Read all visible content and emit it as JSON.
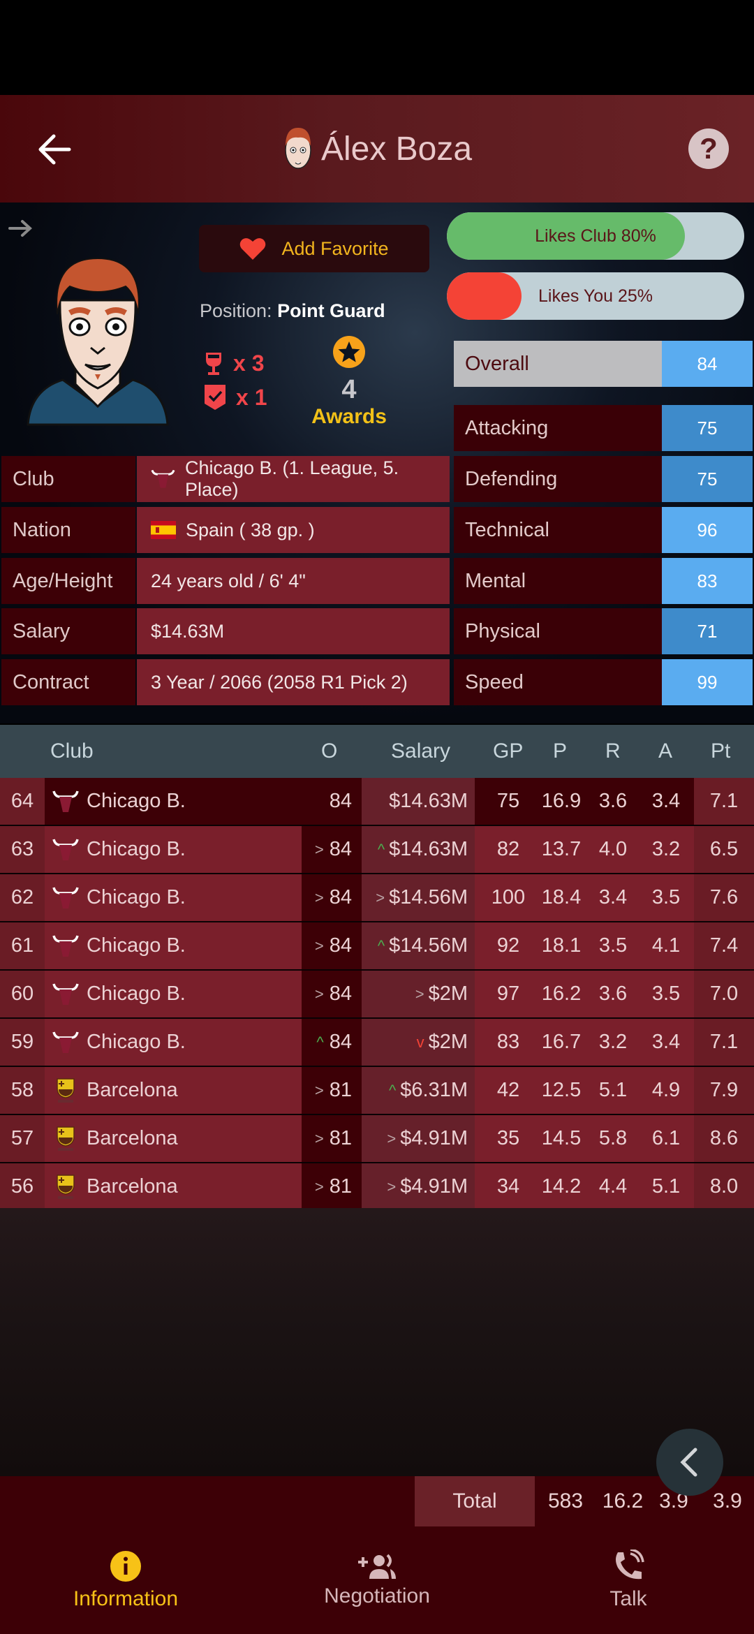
{
  "header": {
    "title": "Álex Boza",
    "back_icon": "arrow-left-icon",
    "help_icon": "question-mark-icon"
  },
  "profile": {
    "favorite_label": "Add Favorite",
    "position_label": "Position:",
    "position_value": "Point Guard",
    "trophies": [
      {
        "icon": "goblet-icon",
        "count": "x 3"
      },
      {
        "icon": "shield-check-icon",
        "count": "x 1"
      }
    ],
    "awards": {
      "count": "4",
      "label": "Awards",
      "icon": "star-badge-icon"
    }
  },
  "mood": [
    {
      "label": "Likes Club 80%",
      "value": 0.8,
      "color": "#66bb6a"
    },
    {
      "label": "Likes You 25%",
      "value": 0.25,
      "color": "#f44336"
    }
  ],
  "attributes": [
    {
      "name": "Overall",
      "value": "84",
      "color": "#5aacf0"
    },
    {
      "name": "Attacking",
      "value": "75",
      "color": "#3e8bcb"
    },
    {
      "name": "Defending",
      "value": "75",
      "color": "#3e8bcb"
    },
    {
      "name": "Technical",
      "value": "96",
      "color": "#5aacf0"
    },
    {
      "name": "Mental",
      "value": "83",
      "color": "#5aacf0"
    },
    {
      "name": "Physical",
      "value": "71",
      "color": "#3e8bcb"
    },
    {
      "name": "Speed",
      "value": "99",
      "color": "#5aacf0"
    }
  ],
  "info": [
    {
      "key": "Club",
      "value": "Chicago B. (1. League, 5. Place)",
      "icon": "bull-logo-icon"
    },
    {
      "key": "Nation",
      "value": "Spain  ( 38 gp. )",
      "icon": "spain-flag-icon"
    },
    {
      "key": "Age/Height",
      "value": "24 years old / 6' 4\""
    },
    {
      "key": "Salary",
      "value": "$14.63M"
    },
    {
      "key": "Contract",
      "value": "3 Year / 2066   (2058 R1 Pick 2)"
    }
  ],
  "history": {
    "columns": [
      "Club",
      "O",
      "Salary",
      "GP",
      "P",
      "R",
      "A",
      "Pt"
    ],
    "rows": [
      {
        "season": "64",
        "club": "Chicago B.",
        "logo": "bull",
        "ovr_trend": "",
        "ovr": "84",
        "sal_trend": "",
        "salary": "$14.63M",
        "gp": "75",
        "p": "16.9",
        "r": "3.6",
        "a": "3.4",
        "pt": "7.1",
        "current": true
      },
      {
        "season": "63",
        "club": "Chicago B.",
        "logo": "bull",
        "ovr_trend": "same",
        "ovr": "84",
        "sal_trend": "up",
        "salary": "$14.63M",
        "gp": "82",
        "p": "13.7",
        "r": "4.0",
        "a": "3.2",
        "pt": "6.5"
      },
      {
        "season": "62",
        "club": "Chicago B.",
        "logo": "bull",
        "ovr_trend": "same",
        "ovr": "84",
        "sal_trend": "same",
        "salary": "$14.56M",
        "gp": "100",
        "p": "18.4",
        "r": "3.4",
        "a": "3.5",
        "pt": "7.6"
      },
      {
        "season": "61",
        "club": "Chicago B.",
        "logo": "bull",
        "ovr_trend": "same",
        "ovr": "84",
        "sal_trend": "up",
        "salary": "$14.56M",
        "gp": "92",
        "p": "18.1",
        "r": "3.5",
        "a": "4.1",
        "pt": "7.4"
      },
      {
        "season": "60",
        "club": "Chicago B.",
        "logo": "bull",
        "ovr_trend": "same",
        "ovr": "84",
        "sal_trend": "same",
        "salary": "$2M",
        "gp": "97",
        "p": "16.2",
        "r": "3.6",
        "a": "3.5",
        "pt": "7.0"
      },
      {
        "season": "59",
        "club": "Chicago B.",
        "logo": "bull",
        "ovr_trend": "up",
        "ovr": "84",
        "sal_trend": "down",
        "salary": "$2M",
        "gp": "83",
        "p": "16.7",
        "r": "3.2",
        "a": "3.4",
        "pt": "7.1"
      },
      {
        "season": "58",
        "club": "Barcelona",
        "logo": "barca",
        "ovr_trend": "same",
        "ovr": "81",
        "sal_trend": "up",
        "salary": "$6.31M",
        "gp": "42",
        "p": "12.5",
        "r": "5.1",
        "a": "4.9",
        "pt": "7.9"
      },
      {
        "season": "57",
        "club": "Barcelona",
        "logo": "barca",
        "ovr_trend": "same",
        "ovr": "81",
        "sal_trend": "same",
        "salary": "$4.91M",
        "gp": "35",
        "p": "14.5",
        "r": "5.8",
        "a": "6.1",
        "pt": "8.6"
      },
      {
        "season": "56",
        "club": "Barcelona",
        "logo": "barca",
        "ovr_trend": "same",
        "ovr": "81",
        "sal_trend": "same",
        "salary": "$4.91M",
        "gp": "34",
        "p": "14.2",
        "r": "4.4",
        "a": "5.1",
        "pt": "8.0"
      }
    ],
    "totals": {
      "label": "Total",
      "gp": "583",
      "p": "16.2",
      "r": "3.9",
      "a": "3.9"
    }
  },
  "nav": {
    "items": [
      {
        "label": "Information",
        "icon": "info-icon",
        "active": true
      },
      {
        "label": "Negotiation",
        "icon": "add-people-icon",
        "active": false
      },
      {
        "label": "Talk",
        "icon": "phone-call-icon",
        "active": false
      }
    ]
  },
  "colors": {
    "accent": "#f7c217",
    "header": "#5a1a1e",
    "row": "#7a1f2b",
    "dark": "#3d0006"
  }
}
